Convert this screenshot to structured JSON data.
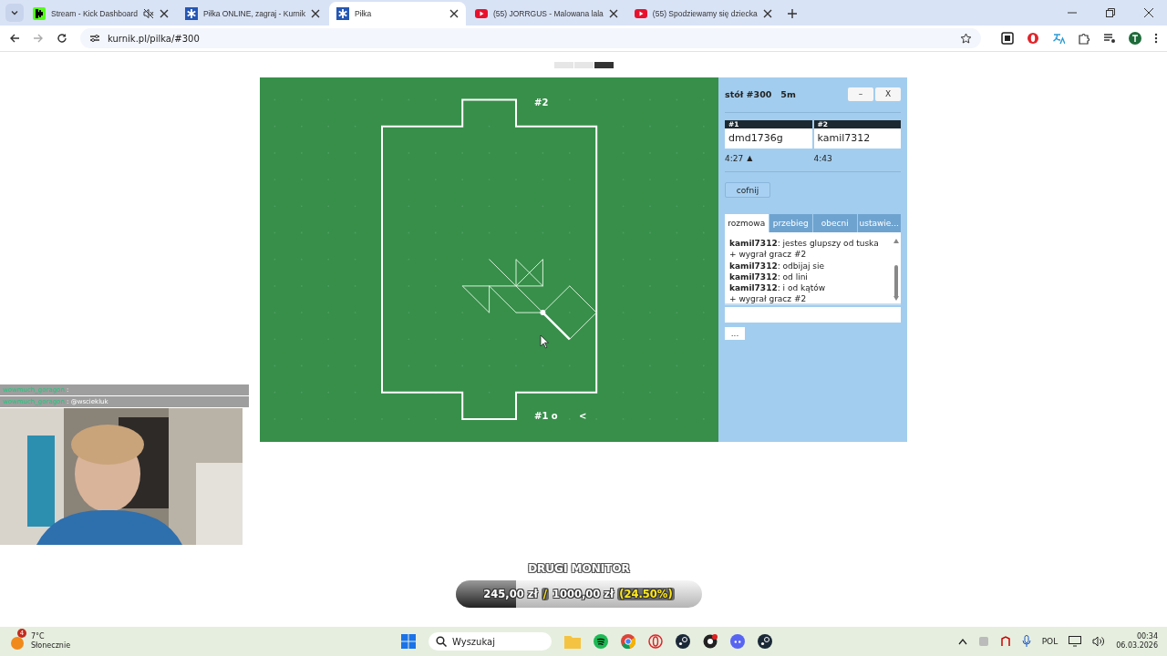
{
  "browser": {
    "tabs": [
      {
        "title": "Stream - Kick Dashboard",
        "kind": "kick",
        "muted": true,
        "selected": false
      },
      {
        "title": "Piłka ONLINE, zagraj - Kurnik",
        "kind": "kurnik",
        "muted": false,
        "selected": false
      },
      {
        "title": "Piłka",
        "kind": "kurnik",
        "muted": false,
        "selected": true
      },
      {
        "title": "(55) JORRGUS - Malowana lala",
        "kind": "youtube",
        "muted": false,
        "selected": false
      },
      {
        "title": "(55) Spodziewamy się dziecka",
        "kind": "youtube",
        "muted": false,
        "selected": false
      }
    ],
    "address": "kurnik.pl/pilka/#300"
  },
  "game": {
    "top_label": "#2",
    "bottom_label": "#1 o",
    "back": "<",
    "panel": {
      "table": "stół #300",
      "time_control": "5m",
      "minimize": "–",
      "close": "X",
      "players": [
        {
          "number": "#1",
          "name": "dmd1736g",
          "clock": "4:27",
          "to_move": true
        },
        {
          "number": "#2",
          "name": "kamil7312",
          "clock": "4:43",
          "to_move": false
        }
      ],
      "to_move_mark": "▲",
      "undo": "cofnij",
      "tabs": [
        {
          "label": "rozmowa",
          "selected": true
        },
        {
          "label": "przebieg",
          "selected": false
        },
        {
          "label": "obecni",
          "selected": false
        },
        {
          "label": "ustawie...",
          "selected": false
        }
      ],
      "chat": [
        {
          "kind": "message",
          "user": "kamil7312",
          "text": ": jestes glupszy od tuska"
        },
        {
          "kind": "system",
          "text": "+ wygrał gracz #2"
        },
        {
          "kind": "message",
          "user": "kamil7312",
          "text": ": odbijaj sie"
        },
        {
          "kind": "message",
          "user": "kamil7312",
          "text": ": od lini"
        },
        {
          "kind": "message",
          "user": "kamil7312",
          "text": ": i od kątów"
        },
        {
          "kind": "system",
          "text": "+ wygrał gracz #2"
        }
      ],
      "more": "..."
    }
  },
  "stream_overlay": {
    "chat": [
      {
        "user": "wowmuch_goragon",
        "text": ":"
      },
      {
        "user": "wowmuch_goragon",
        "text": ": @wsciekluk"
      }
    ],
    "goal": {
      "title": "DRUGI MONITOR",
      "raised": "245,00 zł",
      "separator": "/",
      "target": "1000,00 zł",
      "percent": "(24.50%)",
      "level": 0.245
    }
  },
  "taskbar": {
    "weather_badge": "4",
    "temperature": "7°C",
    "weather": "Słonecznie",
    "search": {
      "placeholder": "Wyszukaj"
    },
    "language": "POL",
    "time": "00:34",
    "date": "06.03.2026"
  }
}
